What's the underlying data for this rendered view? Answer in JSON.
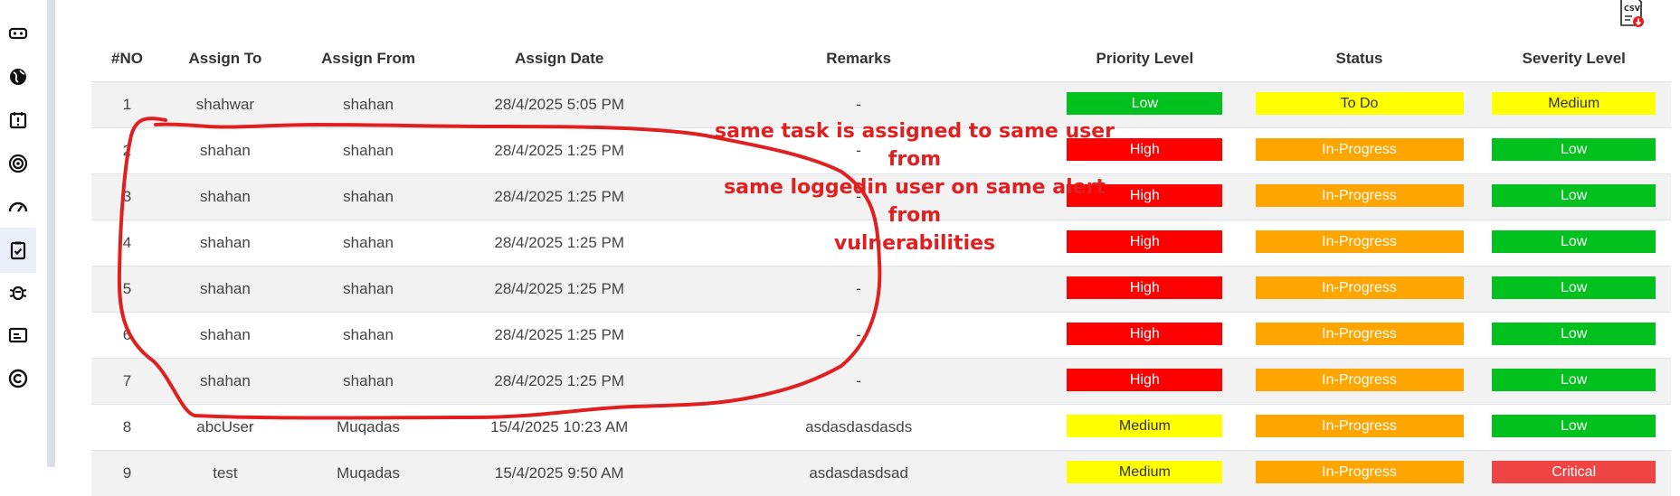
{
  "sidebar": {
    "items": [
      {
        "icon": "vr-headset-icon"
      },
      {
        "icon": "globe-icon"
      },
      {
        "icon": "alert-calendar-icon"
      },
      {
        "icon": "target-icon"
      },
      {
        "icon": "gauge-icon"
      },
      {
        "icon": "task-clipboard-icon",
        "active": true
      },
      {
        "icon": "bug-icon"
      },
      {
        "icon": "id-card-icon"
      },
      {
        "icon": "copyright-circle-icon"
      }
    ]
  },
  "export": {
    "label": "CSV"
  },
  "table": {
    "headers": [
      "#NO",
      "Assign To",
      "Assign From",
      "Assign Date",
      "Remarks",
      "Priority Level",
      "Status",
      "Severity Level"
    ],
    "rows": [
      {
        "no": "1",
        "to": "shahwar",
        "from": "shahan",
        "date": "28/4/2025 5:05 PM",
        "remarks": "-",
        "priority": "Low",
        "status": "To Do",
        "severity": "Medium"
      },
      {
        "no": "2",
        "to": "shahan",
        "from": "shahan",
        "date": "28/4/2025 1:25 PM",
        "remarks": "-",
        "priority": "High",
        "status": "In-Progress",
        "severity": "Low"
      },
      {
        "no": "3",
        "to": "shahan",
        "from": "shahan",
        "date": "28/4/2025 1:25 PM",
        "remarks": "-",
        "priority": "High",
        "status": "In-Progress",
        "severity": "Low"
      },
      {
        "no": "4",
        "to": "shahan",
        "from": "shahan",
        "date": "28/4/2025 1:25 PM",
        "remarks": "-",
        "priority": "High",
        "status": "In-Progress",
        "severity": "Low"
      },
      {
        "no": "5",
        "to": "shahan",
        "from": "shahan",
        "date": "28/4/2025 1:25 PM",
        "remarks": "-",
        "priority": "High",
        "status": "In-Progress",
        "severity": "Low"
      },
      {
        "no": "6",
        "to": "shahan",
        "from": "shahan",
        "date": "28/4/2025 1:25 PM",
        "remarks": "-",
        "priority": "High",
        "status": "In-Progress",
        "severity": "Low"
      },
      {
        "no": "7",
        "to": "shahan",
        "from": "shahan",
        "date": "28/4/2025 1:25 PM",
        "remarks": "-",
        "priority": "High",
        "status": "In-Progress",
        "severity": "Low"
      },
      {
        "no": "8",
        "to": "abcUser",
        "from": "Muqadas",
        "date": "15/4/2025 10:23 AM",
        "remarks": "asdasdasdasds",
        "priority": "Medium",
        "status": "In-Progress",
        "severity": "Low"
      },
      {
        "no": "9",
        "to": "test",
        "from": "Muqadas",
        "date": "15/4/2025 9:50 AM",
        "remarks": "asdasdasdsad",
        "priority": "Medium",
        "status": "In-Progress",
        "severity": "Critical"
      }
    ]
  },
  "annotation": {
    "lines": [
      "same task is assigned to same user from",
      "same loggedin user on same alert from",
      "vulnerabilities"
    ],
    "color": "#e02020"
  },
  "colors": {
    "High": "#ff0000",
    "Low": "#00c11d",
    "Medium": "#ffff00",
    "In-Progress": "#ffa500",
    "To Do": "#ffff00",
    "Critical": "#ee4444"
  }
}
